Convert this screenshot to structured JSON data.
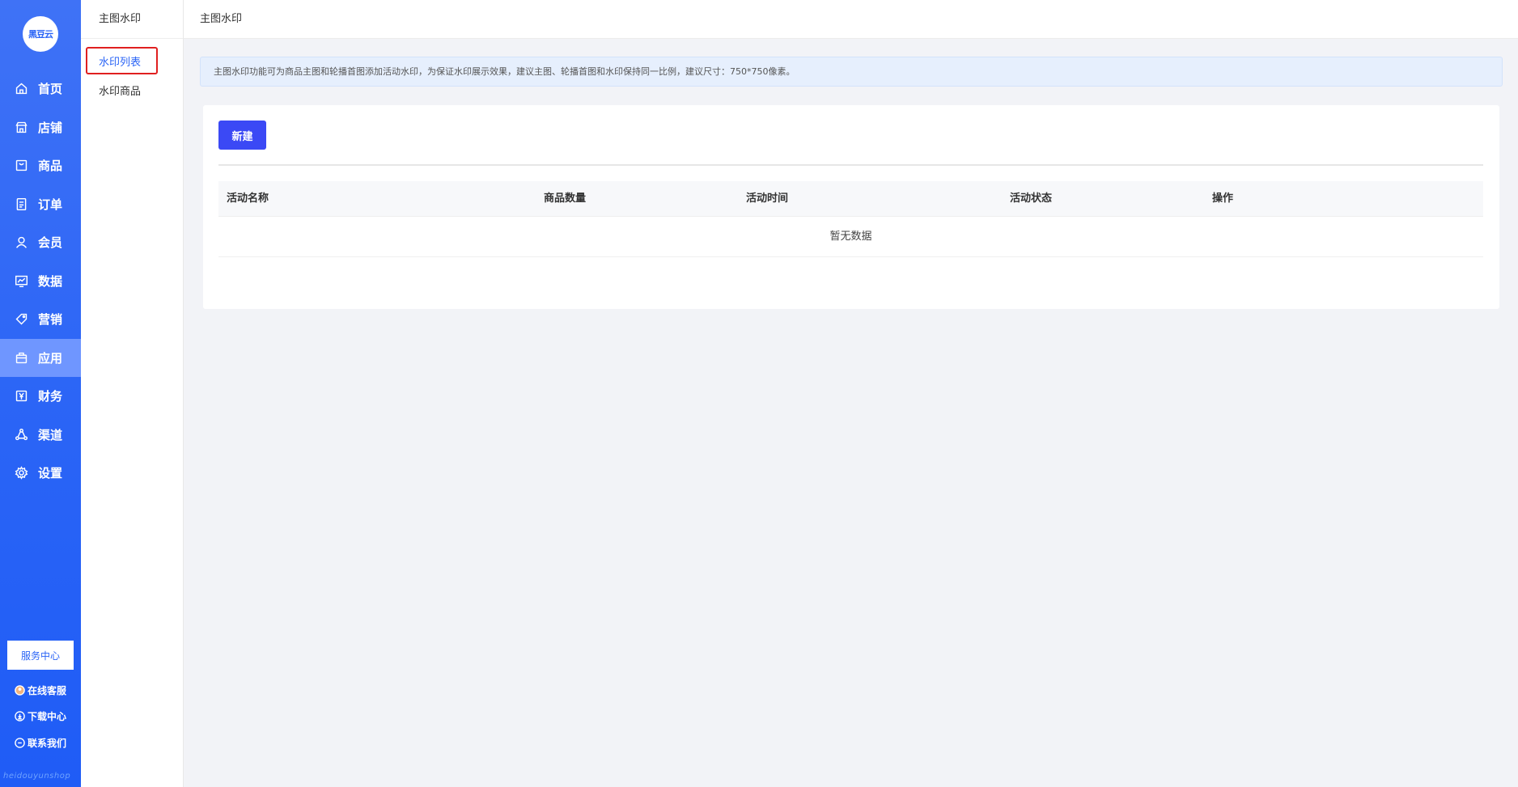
{
  "sidebar": {
    "logo_text": "黑豆云",
    "items": [
      {
        "label": "首页",
        "icon": "home-icon"
      },
      {
        "label": "店铺",
        "icon": "store-icon"
      },
      {
        "label": "商品",
        "icon": "goods-icon"
      },
      {
        "label": "订单",
        "icon": "order-icon"
      },
      {
        "label": "会员",
        "icon": "member-icon"
      },
      {
        "label": "数据",
        "icon": "chart-icon"
      },
      {
        "label": "营销",
        "icon": "tag-icon"
      },
      {
        "label": "应用",
        "icon": "app-icon",
        "active": true
      },
      {
        "label": "财务",
        "icon": "finance-icon"
      },
      {
        "label": "渠道",
        "icon": "channel-icon"
      },
      {
        "label": "设置",
        "icon": "gear-icon"
      }
    ],
    "service_center": "服务中心",
    "online_service": "在线客服",
    "download_center": "下载中心",
    "contact_us": "联系我们",
    "footer_text": "heidouyunshop"
  },
  "subnav": {
    "title": "主图水印",
    "items": [
      {
        "label": "水印列表",
        "active": true
      },
      {
        "label": "水印商品",
        "active": false
      }
    ]
  },
  "header": {
    "breadcrumb": "主图水印"
  },
  "notice": {
    "text": "主图水印功能可为商品主图和轮播首图添加活动水印，为保证水印展示效果，建议主图、轮播首图和水印保持同一比例，建议尺寸：750*750像素。"
  },
  "main": {
    "new_button": "新建",
    "table": {
      "columns": [
        "活动名称",
        "商品数量",
        "活动时间",
        "活动状态",
        "操作"
      ],
      "rows": [],
      "empty_text": "暂无数据"
    }
  },
  "colors": {
    "primary": "#2a64f6",
    "button": "#3b49f5",
    "highlight": "#e02020",
    "notice_bg": "#e6effd"
  }
}
